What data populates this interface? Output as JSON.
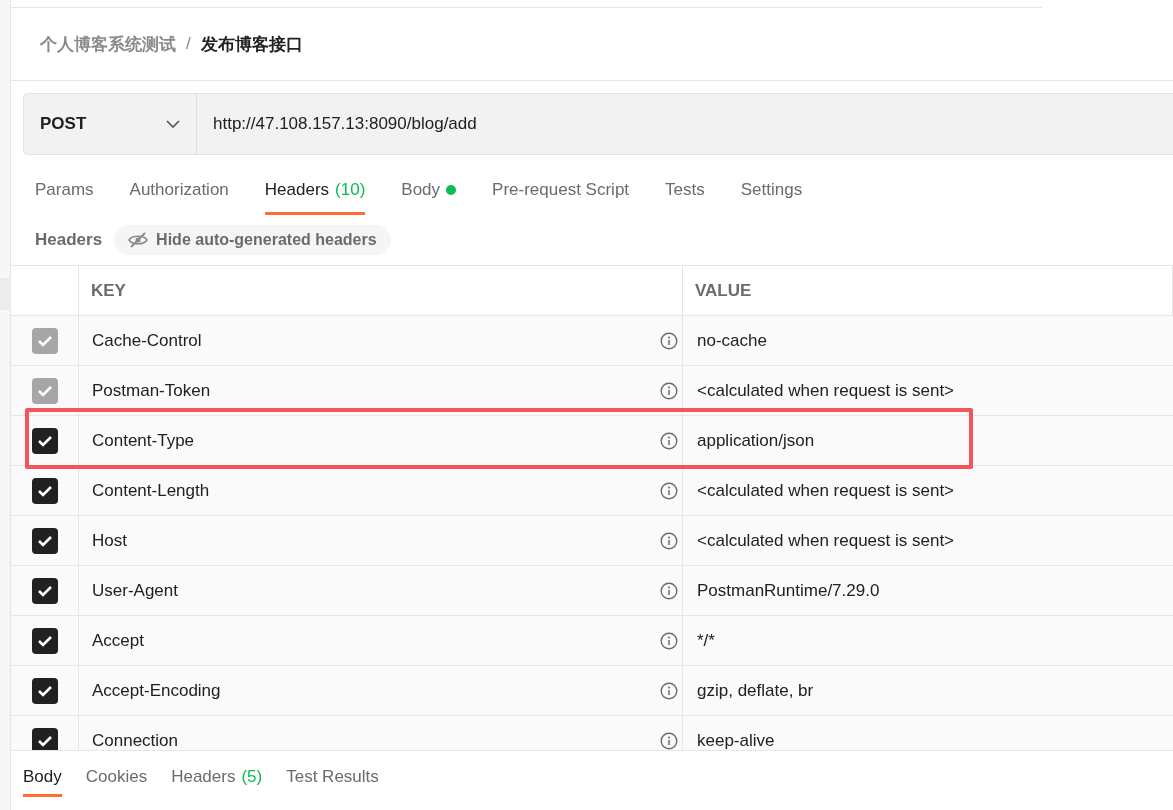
{
  "breadcrumb": {
    "parent": "个人博客系统测试",
    "separator": "/",
    "current": "发布博客接口"
  },
  "request": {
    "method": "POST",
    "url": "http://47.108.157.13:8090/blog/add"
  },
  "tabs": [
    {
      "label": "Params",
      "selected": false
    },
    {
      "label": "Authorization",
      "selected": false
    },
    {
      "label": "Headers",
      "count": "(10)",
      "selected": true
    },
    {
      "label": "Body",
      "dot": true,
      "selected": false
    },
    {
      "label": "Pre-request Script",
      "selected": false
    },
    {
      "label": "Tests",
      "selected": false
    },
    {
      "label": "Settings",
      "selected": false
    }
  ],
  "headers_bar": {
    "label": "Headers",
    "toggle": "Hide auto-generated headers"
  },
  "table": {
    "columns": [
      "KEY",
      "VALUE"
    ],
    "rows": [
      {
        "key": "Cache-Control",
        "value": "no-cache",
        "checked": true,
        "disabled": true,
        "highlighted": false
      },
      {
        "key": "Postman-Token",
        "value": "<calculated when request is sent>",
        "checked": true,
        "disabled": true,
        "highlighted": false
      },
      {
        "key": "Content-Type",
        "value": "application/json",
        "checked": true,
        "disabled": false,
        "highlighted": true
      },
      {
        "key": "Content-Length",
        "value": "<calculated when request is sent>",
        "checked": true,
        "disabled": false,
        "highlighted": false
      },
      {
        "key": "Host",
        "value": "<calculated when request is sent>",
        "checked": true,
        "disabled": false,
        "highlighted": false
      },
      {
        "key": "User-Agent",
        "value": "PostmanRuntime/7.29.0",
        "checked": true,
        "disabled": false,
        "highlighted": false
      },
      {
        "key": "Accept",
        "value": "*/*",
        "checked": true,
        "disabled": false,
        "highlighted": false
      },
      {
        "key": "Accept-Encoding",
        "value": "gzip, deflate, br",
        "checked": true,
        "disabled": false,
        "highlighted": false
      },
      {
        "key": "Connection",
        "value": "keep-alive",
        "checked": true,
        "disabled": false,
        "highlighted": false
      }
    ]
  },
  "response_tabs": [
    {
      "label": "Body",
      "selected": true
    },
    {
      "label": "Cookies",
      "selected": false
    },
    {
      "label": "Headers",
      "count": "(5)",
      "selected": false
    },
    {
      "label": "Test Results",
      "selected": false
    }
  ]
}
